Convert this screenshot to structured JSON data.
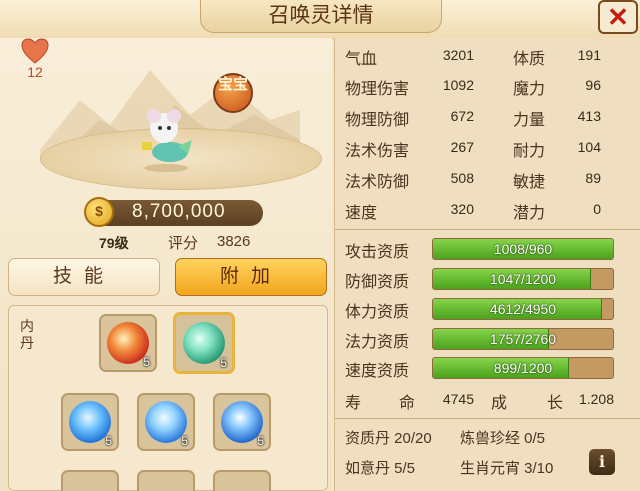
{
  "title": "召唤灵详情",
  "close_icon": "✕",
  "likes": "12",
  "treasure_badge": "宝宝",
  "coins": "8,700,000",
  "level": "79级",
  "score_label": "评分",
  "score": "3826",
  "tabs": [
    {
      "label": "技能",
      "active": false
    },
    {
      "label": "附加",
      "active": true
    }
  ],
  "neidan_label": "内丹",
  "neidan_slots": [
    {
      "icon": "fire-core-icon",
      "count": "5",
      "color": "#e2472a"
    },
    {
      "icon": "jade-core-icon",
      "count": "5",
      "color": "#3dbf8e"
    }
  ],
  "skill_slots": [
    {
      "icon": "water-skill-icon",
      "count": "5"
    },
    {
      "icon": "ice-skill-icon",
      "count": "5"
    },
    {
      "icon": "eye-skill-icon",
      "count": "5"
    }
  ],
  "stats": [
    {
      "l1": "气血",
      "v1": "3201",
      "l2": "体质",
      "v2": "191"
    },
    {
      "l1": "物理伤害",
      "v1": "1092",
      "l2": "魔力",
      "v2": "96"
    },
    {
      "l1": "物理防御",
      "v1": "672",
      "l2": "力量",
      "v2": "413"
    },
    {
      "l1": "法术伤害",
      "v1": "267",
      "l2": "耐力",
      "v2": "104"
    },
    {
      "l1": "法术防御",
      "v1": "508",
      "l2": "敏捷",
      "v2": "89"
    },
    {
      "l1": "速度",
      "v1": "320",
      "l2": "潜力",
      "v2": "0"
    }
  ],
  "aptitudes": [
    {
      "label": "攻击资质",
      "text": "1008/960",
      "fill": 1.0
    },
    {
      "label": "防御资质",
      "text": "1047/1200",
      "fill": 0.8725
    },
    {
      "label": "体力资质",
      "text": "4612/4950",
      "fill": 0.9317
    },
    {
      "label": "法力资质",
      "text": "1757/2760",
      "fill": 0.6366
    },
    {
      "label": "速度资质",
      "text": "899/1200",
      "fill": 0.7492
    }
  ],
  "lifespan": {
    "label_a": "寿",
    "label_b": "命",
    "value": "4745",
    "growth_a": "成",
    "growth_b": "长",
    "growth_value": "1.208"
  },
  "items": {
    "row1_a": "资质丹 20/20",
    "row1_b": "炼兽珍经 0/5",
    "row2_a": "如意丹 5/5",
    "row2_b": "生肖元宵 3/10"
  },
  "info_icon": "i",
  "colors": {
    "accent": "#f2a51d",
    "bar_green": "#5bb52a",
    "title_brown": "#5b3414"
  }
}
